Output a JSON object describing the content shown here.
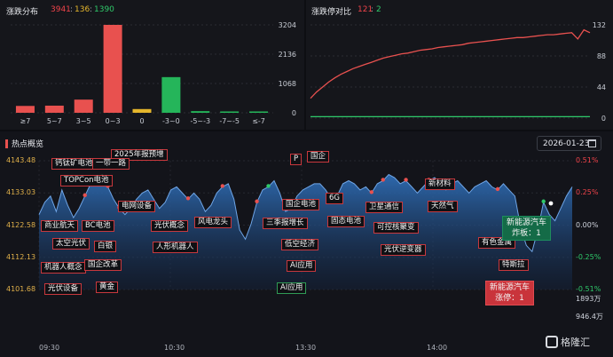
{
  "dist": {
    "title": "涨跌分布",
    "up": "3941",
    "flat": "136",
    "down": "1390",
    "yticks": [
      "3204",
      "2136",
      "1068",
      "0"
    ],
    "chart_data": {
      "type": "bar",
      "categories": [
        "≥7",
        "5~7",
        "3~5",
        "0~3",
        "0",
        "-3~0",
        "-5~-3",
        "-7~-5",
        "≤-7"
      ],
      "values": [
        250,
        260,
        480,
        3204,
        136,
        1300,
        60,
        20,
        10
      ],
      "colors": [
        "#e8514f",
        "#e8514f",
        "#e8514f",
        "#e8514f",
        "#e5b62c",
        "#25b55a",
        "#25b55a",
        "#25b55a",
        "#25b55a"
      ],
      "ylim": [
        0,
        3204
      ]
    }
  },
  "limit": {
    "title": "涨跌停对比",
    "up": "121",
    "down": "2",
    "yticks": [
      "132",
      "88",
      "44",
      "0"
    ],
    "chart_data": {
      "type": "line",
      "ylim": [
        0,
        132
      ],
      "series": [
        {
          "color": "#e8514f",
          "values": [
            28,
            37,
            44,
            51,
            57,
            62,
            66,
            70,
            73,
            76,
            79,
            82,
            85,
            87,
            89,
            91,
            92,
            94,
            96,
            97,
            98,
            100,
            101,
            102,
            103,
            104,
            106,
            107,
            108,
            109,
            110,
            111,
            112,
            113,
            114,
            114,
            115,
            116,
            117,
            118,
            118,
            119,
            120,
            121,
            112,
            125,
            121
          ]
        },
        {
          "color": "#2fc96a",
          "values": [
            2,
            2,
            2,
            2,
            2,
            2,
            2,
            2,
            2,
            2,
            2,
            2,
            2,
            2,
            2,
            2,
            2,
            2,
            2,
            2,
            2,
            2,
            2,
            2,
            2,
            2,
            2,
            2,
            2,
            2,
            2,
            2,
            2,
            2,
            2,
            2,
            2,
            2,
            2,
            2,
            2,
            2,
            2,
            2,
            2,
            2,
            2
          ]
        }
      ]
    }
  },
  "hot": {
    "title": "热点概览",
    "date": "2026-01-23",
    "left_ticks": [
      "4143.48",
      "4133.03",
      "4122.58",
      "4112.13",
      "4101.68"
    ],
    "right_ticks": [
      "0.51%",
      "0.25%",
      "0.00%",
      "-0.25%",
      "-0.51%"
    ],
    "vol_ticks": [
      "1893万",
      "946.4万"
    ],
    "times": [
      "09:30",
      "10:30",
      "13:30",
      "14:00"
    ],
    "logo": "格隆汇",
    "tags": [
      {
        "t": "钙钛矿电池",
        "c": "r"
      },
      {
        "t": "2025年报预增",
        "c": "r"
      },
      {
        "t": "一带一路",
        "c": "r"
      },
      {
        "t": "TOPCon电池",
        "c": "r"
      },
      {
        "t": "商业航天",
        "c": "r"
      },
      {
        "t": "BC电池",
        "c": "r"
      },
      {
        "t": "太空光伏",
        "c": "r"
      },
      {
        "t": "白银",
        "c": "r"
      },
      {
        "t": "机器人概念",
        "c": "r"
      },
      {
        "t": "国企改革",
        "c": "r"
      },
      {
        "t": "光伏设备",
        "c": "r"
      },
      {
        "t": "黄金",
        "c": "r"
      },
      {
        "t": "电网设备",
        "c": "r"
      },
      {
        "t": "光伏概念",
        "c": "r"
      },
      {
        "t": "人形机器人",
        "c": "r"
      },
      {
        "t": "风电龙头",
        "c": "r"
      },
      {
        "t": "P",
        "c": "r"
      },
      {
        "t": "国企",
        "c": "r"
      },
      {
        "t": "国企电池",
        "c": "r"
      },
      {
        "t": "6G",
        "c": "r"
      },
      {
        "t": "三季报增长",
        "c": "r"
      },
      {
        "t": "固态电池",
        "c": "r"
      },
      {
        "t": "低空经济",
        "c": "r"
      },
      {
        "t": "AI应用",
        "c": "r"
      },
      {
        "t": "AI应用",
        "c": "g"
      },
      {
        "t": "卫星通信",
        "c": "r"
      },
      {
        "t": "可控核聚变",
        "c": "r"
      },
      {
        "t": "光伏逆变器",
        "c": "r"
      },
      {
        "t": "新材料",
        "c": "r"
      },
      {
        "t": "天然气",
        "c": "r"
      },
      {
        "t": "有色金属",
        "c": "r"
      },
      {
        "t": "特斯拉",
        "c": "r"
      }
    ],
    "call_green": {
      "line1": "新能源汽车",
      "line2": "炸板：1"
    },
    "call_red": {
      "line1": "新能源汽车",
      "line2": "涨停：1"
    },
    "chart_data": {
      "type": "area",
      "ylim": [
        4101.68,
        4143.48
      ],
      "values": [
        4126,
        4130,
        4132,
        4127,
        4134,
        4129,
        4125,
        4128,
        4132,
        4136,
        4137,
        4138,
        4135,
        4131,
        4128,
        4126,
        4128,
        4131,
        4133,
        4134,
        4131,
        4128,
        4130,
        4134,
        4135,
        4133,
        4131,
        4133,
        4131,
        4127,
        4129,
        4133,
        4135,
        4136,
        4131,
        4121,
        4118,
        4123,
        4130,
        4134,
        4135,
        4137,
        4133,
        4127,
        4128,
        4132,
        4134,
        4135,
        4136,
        4136,
        4134,
        4131,
        4132,
        4136,
        4137,
        4136,
        4134,
        4135,
        4133,
        4136,
        4137,
        4139,
        4138,
        4136,
        4137,
        4135,
        4133,
        4135,
        4137,
        4138,
        4136,
        4134,
        4136,
        4137,
        4135,
        4133,
        4135,
        4136,
        4137,
        4135,
        4134,
        4136,
        4134,
        4132,
        4122,
        4116,
        4114,
        4121,
        4130,
        4126,
        4124,
        4128,
        4132,
        4135
      ]
    }
  }
}
